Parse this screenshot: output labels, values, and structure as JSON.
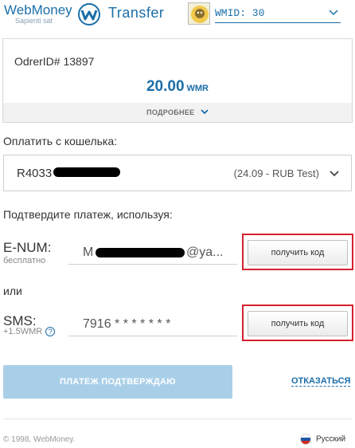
{
  "header": {
    "logo_text": "WebMoney",
    "logo_sub": "Sapienti sat",
    "logo_transfer": "Transfer",
    "wmid_label": "WMID: 30"
  },
  "order": {
    "id_label": "OdrerID# 13897",
    "amount": "20.00",
    "currency": "WMR",
    "details_label": "ПОДРОБНЕЕ"
  },
  "wallet": {
    "section_label": "Оплатить с кошелька:",
    "id_prefix": "R4033",
    "balance": "(24.09 - RUB Test)"
  },
  "confirm": {
    "section_label": "Подтвердите платеж, используя:",
    "enum_label": "E-NUM:",
    "enum_sub": "бесплатно",
    "enum_value_prefix": "M",
    "enum_value_suffix": "@ya...",
    "get_code_label": "получить код",
    "or_label": "или",
    "sms_label": "SMS:",
    "sms_sub": "+1.5WMR",
    "help_glyph": "?",
    "sms_value": "7916 * * * * * * *"
  },
  "actions": {
    "confirm_label": "ПЛАТЕЖ ПОДТВЕРЖДАЮ",
    "cancel_label": "ОТКАЗАТЬСЯ"
  },
  "footer": {
    "copyright": "© 1998, WebMoney.",
    "language": "Русский"
  },
  "colors": {
    "brand_blue": "#1b6ea8",
    "highlight_red": "#d6202d",
    "disabled_button": "#a9cfe8"
  }
}
